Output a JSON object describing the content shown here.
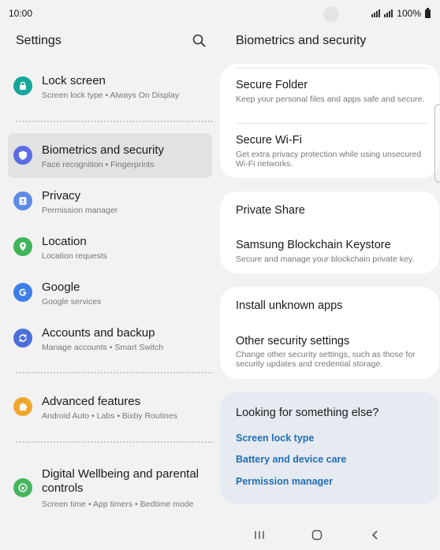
{
  "status": {
    "time": "10:00",
    "battery": "100%"
  },
  "left_panel": {
    "title": "Settings",
    "items": [
      {
        "title": "Lock screen",
        "subtitle": "Screen lock type  •  Always On Display",
        "icon": "lock-icon",
        "color": "#15a79a"
      },
      {
        "title": "Biometrics and security",
        "subtitle": "Face recognition  •  Fingerprints",
        "icon": "shield-icon",
        "color": "#5b6ce3"
      },
      {
        "title": "Privacy",
        "subtitle": "Permission manager",
        "icon": "privacy-icon",
        "color": "#5d8be6"
      },
      {
        "title": "Location",
        "subtitle": "Location requests",
        "icon": "location-pin-icon",
        "color": "#3fb45a"
      },
      {
        "title": "Google",
        "subtitle": "Google services",
        "icon": "google-icon",
        "color": "#3d7ee8"
      },
      {
        "title": "Accounts and backup",
        "subtitle": "Manage accounts  •  Smart Switch",
        "icon": "sync-icon",
        "color": "#4d6ed9"
      },
      {
        "title": "Advanced features",
        "subtitle": "Android Auto  •  Labs  •  Bixby Routines",
        "icon": "puzzle-icon",
        "color": "#f0a72f"
      },
      {
        "title": "Digital Wellbeing and parental",
        "title2": "controls",
        "subtitle": "Screen time  •  App timers  •  Bedtime mode",
        "icon": "wellbeing-icon",
        "color": "#43b65e"
      }
    ]
  },
  "right_panel": {
    "title": "Biometrics and security",
    "card1": [
      {
        "title": "Secure Folder",
        "subtitle": "Keep your personal files and apps safe and secure."
      },
      {
        "title": "Secure Wi-Fi",
        "subtitle": "Get extra privacy protection while using unsecured Wi-Fi networks."
      }
    ],
    "card2": [
      {
        "title": "Private Share"
      },
      {
        "title": "Samsung Blockchain Keystore",
        "subtitle": "Secure and manage your blockchain private key."
      }
    ],
    "card3": [
      {
        "title": "Install unknown apps"
      },
      {
        "title": "Other security settings",
        "subtitle": "Change other security settings, such as those for security updates and credential storage."
      }
    ],
    "looking": {
      "title": "Looking for something else?",
      "links": [
        "Screen lock type",
        "Battery and device care",
        "Permission manager"
      ]
    }
  },
  "colors": {
    "link": "#1f6fb8",
    "selected_row": "#e2e2e2",
    "accent": "#5b6ce3"
  }
}
